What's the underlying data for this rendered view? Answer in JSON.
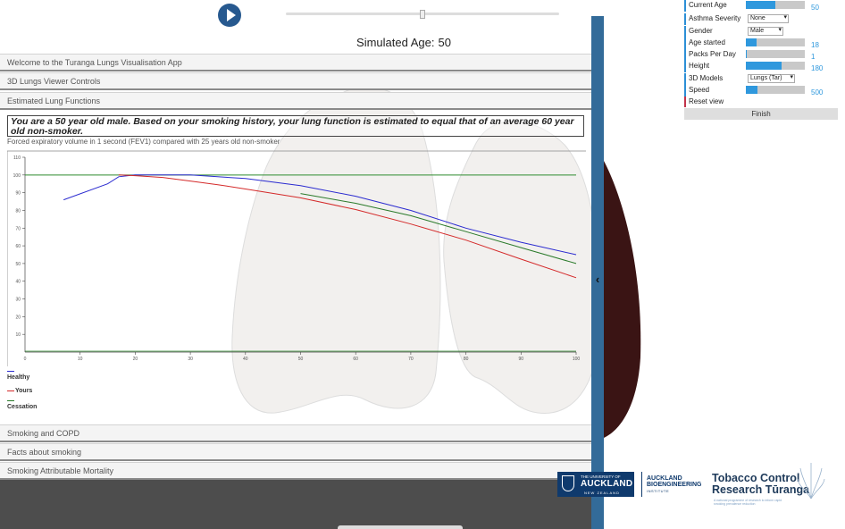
{
  "player": {
    "simulated_age_label": "Simulated Age:",
    "simulated_age_value": "50"
  },
  "sections": {
    "welcome": "Welcome to the Turanga Lungs Visualisation App",
    "viewer_controls": "3D Lungs Viewer Controls",
    "lung_functions": "Estimated Lung Functions",
    "copd": "Smoking and COPD",
    "facts": "Facts about smoking",
    "mortality": "Smoking Attributable Mortality"
  },
  "lung_functions": {
    "message": "You are a 50 year old male. Based on your smoking history, your lung function is estimated to equal that of an average 60 year old non-smoker.",
    "caption": "Forced expiratory volume in 1 second (FEV1) compared with 25 years old non-smoker"
  },
  "chart_data": {
    "type": "line",
    "title": "",
    "xlabel": "",
    "ylabel": "",
    "xlim": [
      0,
      100
    ],
    "ylim": [
      0,
      110
    ],
    "xticks": [
      10,
      20,
      30,
      40,
      50,
      60,
      70,
      80,
      90,
      100
    ],
    "yticks": [
      10,
      20,
      30,
      40,
      50,
      60,
      70,
      80,
      90,
      100,
      110
    ],
    "reference": {
      "y": 100,
      "color": "#2e8b2e"
    },
    "series": [
      {
        "name": "Healthy",
        "color": "#2b2bd0",
        "points": [
          [
            7,
            86
          ],
          [
            15,
            95
          ],
          [
            17,
            99
          ],
          [
            20,
            100
          ],
          [
            30,
            100
          ],
          [
            40,
            98
          ],
          [
            50,
            94
          ],
          [
            60,
            88
          ],
          [
            70,
            80
          ],
          [
            80,
            70
          ],
          [
            90,
            62
          ],
          [
            100,
            55
          ]
        ]
      },
      {
        "name": "Yours",
        "color": "#d42a2a",
        "points": [
          [
            17,
            100
          ],
          [
            20,
            99.6
          ],
          [
            25,
            98.6
          ],
          [
            30,
            96.6
          ],
          [
            35,
            94.5
          ],
          [
            40,
            92.1
          ],
          [
            50,
            87.1
          ],
          [
            60,
            80.5
          ],
          [
            70,
            72.3
          ],
          [
            80,
            63.2
          ],
          [
            90,
            52.5
          ],
          [
            100,
            42
          ]
        ]
      },
      {
        "name": "Cessation",
        "color": "#2a7a2a",
        "points": [
          [
            50,
            89.5
          ],
          [
            60,
            84
          ],
          [
            70,
            77
          ],
          [
            80,
            68
          ],
          [
            90,
            59
          ],
          [
            100,
            50
          ]
        ]
      }
    ],
    "legend_position": "bottom-left",
    "legend": [
      "Healthy",
      "Yours",
      "Cessation"
    ]
  },
  "settings": {
    "current_age": {
      "label": "Current Age",
      "fraction": 0.5,
      "value": "50"
    },
    "asthma": {
      "label": "Asthma Severity",
      "value": "None"
    },
    "gender": {
      "label": "Gender",
      "value": "Male"
    },
    "age_started": {
      "label": "Age started",
      "fraction": 0.18,
      "value": "18"
    },
    "packs": {
      "label": "Packs Per Day",
      "fraction": 0.02,
      "value": "1"
    },
    "height": {
      "label": "Height",
      "fraction": 0.6,
      "value": "180"
    },
    "models": {
      "label": "3D Models",
      "value": "Lungs (Tar)"
    },
    "speed": {
      "label": "Speed",
      "fraction": 0.2,
      "value": "500"
    },
    "reset": "Reset view",
    "finish": "Finish"
  },
  "logos": {
    "uoa_line1": "THE UNIVERSITY OF",
    "uoa_line2": "AUCKLAND",
    "uoa_line3": "NEW ZEALAND",
    "abi_line1": "AUCKLAND",
    "abi_line2": "BIOENGINEERING",
    "abi_line3": "INSTITUTE",
    "tcr_line1": "Tobacco Control",
    "tcr_line2": "Research Tūranga",
    "tcr_tagline": "A national programme of research to inform rapid smoking prevalence reduction"
  },
  "colors": {
    "accent": "#2f98dd",
    "panel_blue": "#336b99",
    "play_button": "#27598f",
    "brand_navy": "#0f3a6d"
  }
}
